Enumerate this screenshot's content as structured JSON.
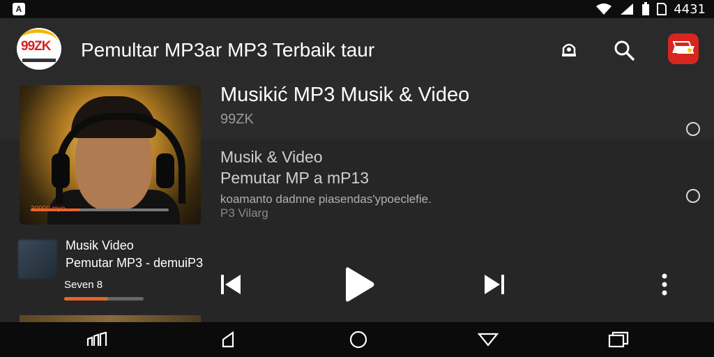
{
  "status_bar": {
    "left_icon": "notification-icon",
    "time": "4431",
    "icons": [
      "wifi-icon",
      "signal-icon",
      "battery-icon",
      "sim-icon"
    ]
  },
  "header": {
    "logo_text": "99ZK",
    "title": "Pemultar MP3ar MP3 Terbaik taur",
    "actions": [
      "account-icon",
      "search-icon",
      "app-avatar-icon"
    ]
  },
  "now_playing": {
    "album_progress_label": "30000 myo",
    "album_progress_fraction": 0.36,
    "title": "Musikić MP3 Musik & Video",
    "artist": "99ZK",
    "info_line_1": "Musik & Video",
    "info_line_2": "Pemutar MP a mP13",
    "info_line_3": "koamanto dadnne piasendas'ypoeclefie.",
    "info_line_4": "P3 Vilarg"
  },
  "mini_player": {
    "title": "Musik Video",
    "subtitle": "Pemutar MP3 - demuiP3",
    "time": "Seven 8",
    "progress_fraction": 0.55
  },
  "controls": [
    "previous-icon",
    "play-icon",
    "next-icon",
    "more-icon"
  ],
  "nav_bar": [
    "recent-apps-icon",
    "back-icon",
    "home-icon",
    "down-icon",
    "overview-icon"
  ],
  "colors": {
    "accent": "#e8632a",
    "background": "#1e1e1e",
    "app_bar": "#2a2a2a",
    "nav_bar": "#0b0b0b",
    "brand_red": "#d61f1f"
  }
}
